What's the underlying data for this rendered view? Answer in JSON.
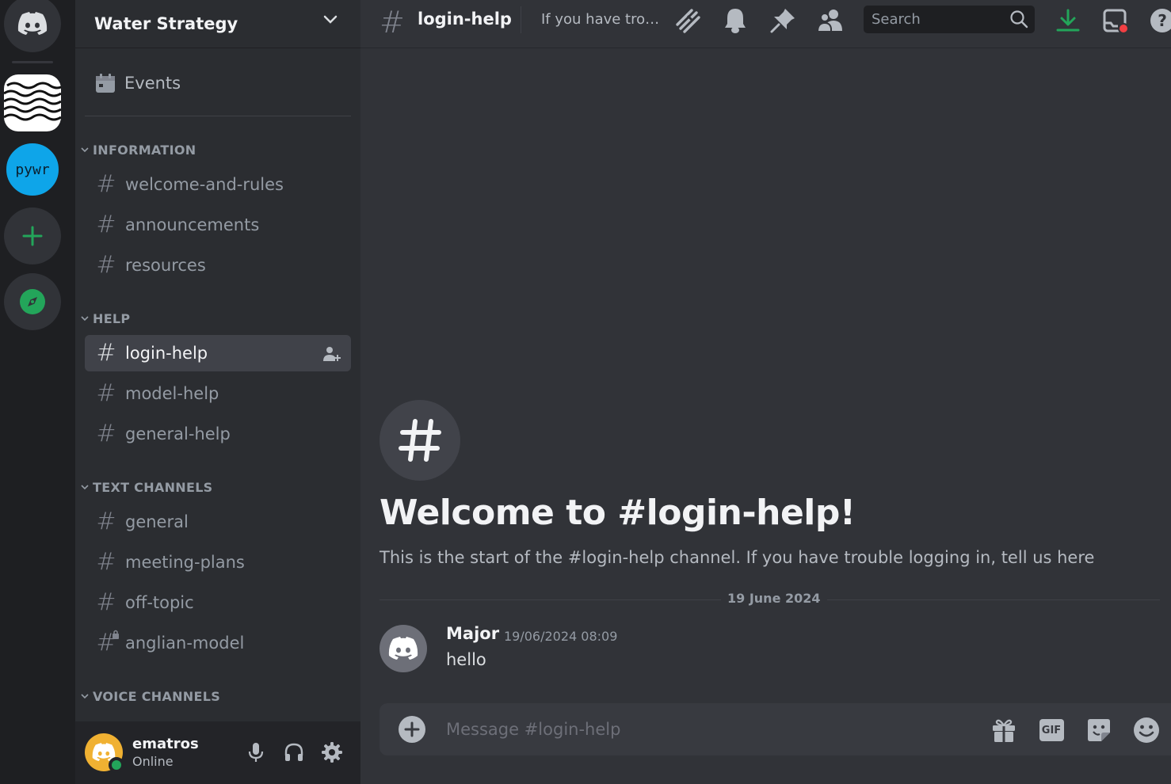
{
  "rail": {
    "servers": [
      {
        "icon": "discord-home-icon"
      },
      {
        "icon": "wave-logo-icon"
      },
      {
        "label": "pywr",
        "color": "#0ea5e9"
      },
      {
        "icon": "add-server-icon"
      },
      {
        "icon": "explore-compass-icon"
      }
    ]
  },
  "guild": {
    "name": "Water Strategy"
  },
  "sidebar": {
    "events_label": "Events",
    "categories": [
      {
        "name": "INFORMATION",
        "channels": [
          "welcome-and-rules",
          "announcements",
          "resources"
        ]
      },
      {
        "name": "HELP",
        "channels": [
          "login-help",
          "model-help",
          "general-help"
        ]
      },
      {
        "name": "TEXT CHANNELS",
        "channels": [
          "general",
          "meeting-plans",
          "off-topic",
          "anglian-model"
        ]
      },
      {
        "name": "VOICE CHANNELS",
        "channels": []
      }
    ],
    "active_channel": "login-help"
  },
  "user": {
    "name": "ematros",
    "status": "Online"
  },
  "topbar": {
    "channel": "login-help",
    "topic": "If you have trouble logging in, tell us here",
    "search_placeholder": "Search"
  },
  "main": {
    "welcome_title": "Welcome to #login-help!",
    "welcome_desc": "This is the start of the #login-help channel. If you have trouble logging in, tell us here",
    "date_label": "19 June 2024",
    "message": {
      "author": "Major",
      "time": "19/06/2024 08:09",
      "text": "hello"
    }
  },
  "composer": {
    "placeholder": "Message #login-help",
    "gif_label": "GIF"
  },
  "colors": {
    "accent_green": "#23a55a",
    "background": "#313338",
    "sidebar": "#2b2d31",
    "rail": "#1e1f22"
  }
}
